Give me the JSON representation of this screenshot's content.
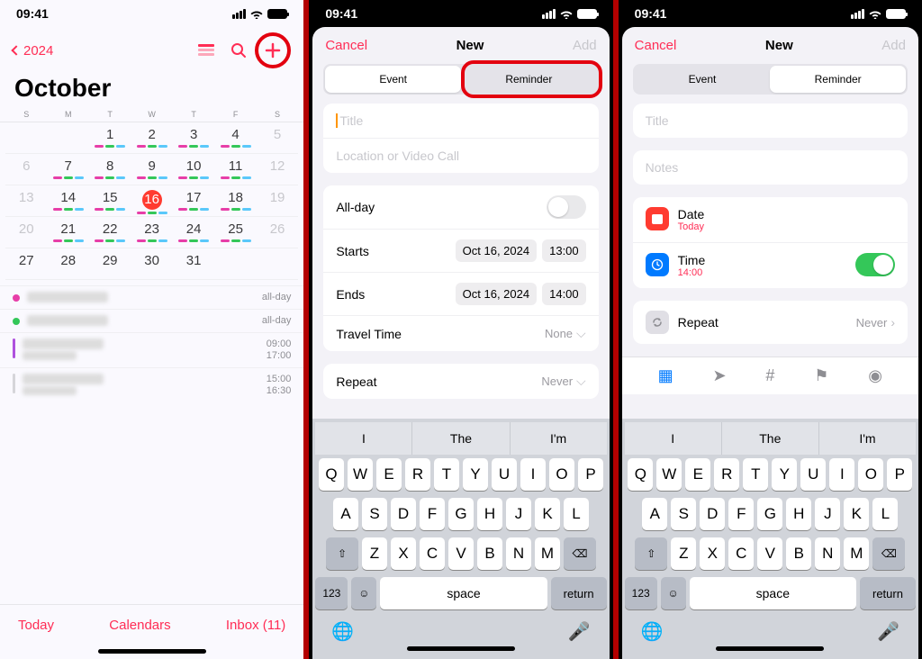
{
  "status": {
    "time": "09:41"
  },
  "screen1": {
    "year": "2024",
    "month": "October",
    "weekdays": [
      "S",
      "M",
      "T",
      "W",
      "T",
      "F",
      "S"
    ],
    "weeks": [
      [
        "",
        "",
        "1",
        "2",
        "3",
        "4",
        "5"
      ],
      [
        "6",
        "7",
        "8",
        "9",
        "10",
        "11",
        "12"
      ],
      [
        "13",
        "14",
        "15",
        "16",
        "17",
        "18",
        "19"
      ],
      [
        "20",
        "21",
        "22",
        "23",
        "24",
        "25",
        "26"
      ],
      [
        "27",
        "28",
        "29",
        "30",
        "31",
        "",
        ""
      ]
    ],
    "today_index": [
      2,
      3
    ],
    "events": [
      {
        "color": "#e73ea8",
        "time": "all-day"
      },
      {
        "color": "#34c759",
        "time": "all-day"
      },
      {
        "color": "#af52de",
        "time": "09:00",
        "time2": "17:00",
        "bar": true
      },
      {
        "color": "#d5d5d9",
        "time": "15:00",
        "time2": "16:30",
        "bar": true
      }
    ],
    "bottom": {
      "today": "Today",
      "calendars": "Calendars",
      "inbox": "Inbox (11)"
    }
  },
  "screen2": {
    "cancel": "Cancel",
    "title": "New",
    "add": "Add",
    "seg_event": "Event",
    "seg_reminder": "Reminder",
    "title_ph": "Title",
    "loc_ph": "Location or Video Call",
    "allday": "All-day",
    "starts": "Starts",
    "starts_date": "Oct 16, 2024",
    "starts_time": "13:00",
    "ends": "Ends",
    "ends_date": "Oct 16, 2024",
    "ends_time": "14:00",
    "travel": "Travel Time",
    "travel_val": "None",
    "repeat": "Repeat",
    "repeat_val": "Never"
  },
  "screen3": {
    "cancel": "Cancel",
    "title": "New",
    "add": "Add",
    "seg_event": "Event",
    "seg_reminder": "Reminder",
    "title_ph": "Title",
    "notes_ph": "Notes",
    "date_label": "Date",
    "date_val": "Today",
    "time_label": "Time",
    "time_val": "14:00",
    "repeat": "Repeat",
    "repeat_val": "Never"
  },
  "keyboard": {
    "pred": [
      "I",
      "The",
      "I'm"
    ],
    "r1": [
      "Q",
      "W",
      "E",
      "R",
      "T",
      "Y",
      "U",
      "I",
      "O",
      "P"
    ],
    "r2": [
      "A",
      "S",
      "D",
      "F",
      "G",
      "H",
      "J",
      "K",
      "L"
    ],
    "r3": [
      "Z",
      "X",
      "C",
      "V",
      "B",
      "N",
      "M"
    ],
    "shift": "⇧",
    "del": "⌫",
    "num": "123",
    "emoji": "☺",
    "space": "space",
    "ret": "return",
    "globe": "🌐",
    "mic": "🎤"
  }
}
